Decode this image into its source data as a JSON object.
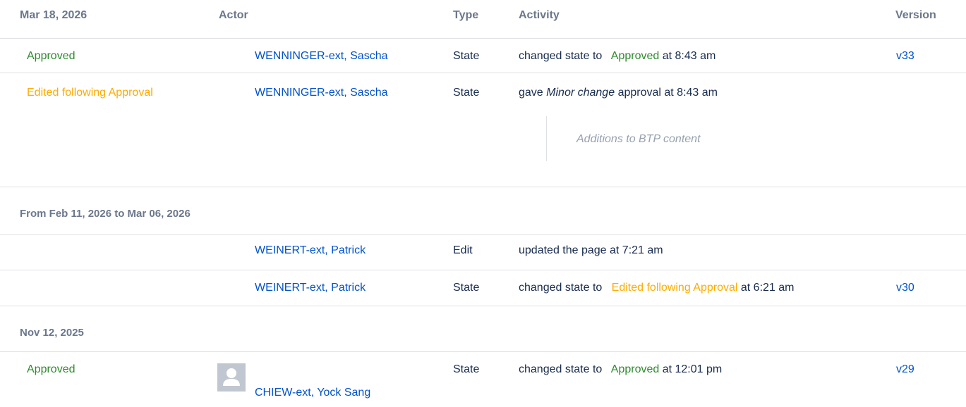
{
  "header": {
    "date": "Mar 18, 2026",
    "actor": "Actor",
    "type": "Type",
    "activity": "Activity",
    "version": "Version"
  },
  "rows": [
    {
      "state": "Approved",
      "actor": "WENNINGER-ext, Sascha",
      "type": "State",
      "activity_prefix": "changed state to",
      "activity_state": "Approved",
      "activity_suffix": "at 8:43 am",
      "version": "v33"
    },
    {
      "state": "Edited following Approval",
      "actor": "WENNINGER-ext, Sascha",
      "type": "State",
      "activity_prefix": "gave",
      "activity_emphasis": "Minor change",
      "activity_suffix": "approval at 8:43 am",
      "comment": "Additions to BTP content"
    }
  ],
  "group2": {
    "label": "From Feb 11, 2026 to Mar 06, 2026",
    "rows": [
      {
        "actor": "WEINERT-ext, Patrick",
        "type": "Edit",
        "activity": "updated the page at 7:21 am"
      },
      {
        "actor": "WEINERT-ext, Patrick",
        "type": "State",
        "activity_prefix": "changed state to",
        "activity_state": "Edited following Approval",
        "activity_suffix": "at 6:21 am",
        "version": "v30"
      }
    ]
  },
  "group3": {
    "label": "Nov 12, 2025",
    "rows": [
      {
        "state": "Approved",
        "actor": "CHIEW-ext, Yock Sang",
        "type": "State",
        "activity_prefix": "changed state to",
        "activity_state": "Approved",
        "activity_suffix": "at 12:01 pm",
        "version": "v29"
      }
    ]
  },
  "colors": {
    "link": "#0052cc",
    "approved": "#2d8a2d",
    "edited": "#ffab00",
    "header": "#6b778c",
    "divider": "#dfe1e6",
    "comment": "#97a0af"
  },
  "icons": {
    "avatar": "default-user-avatar-icon"
  }
}
